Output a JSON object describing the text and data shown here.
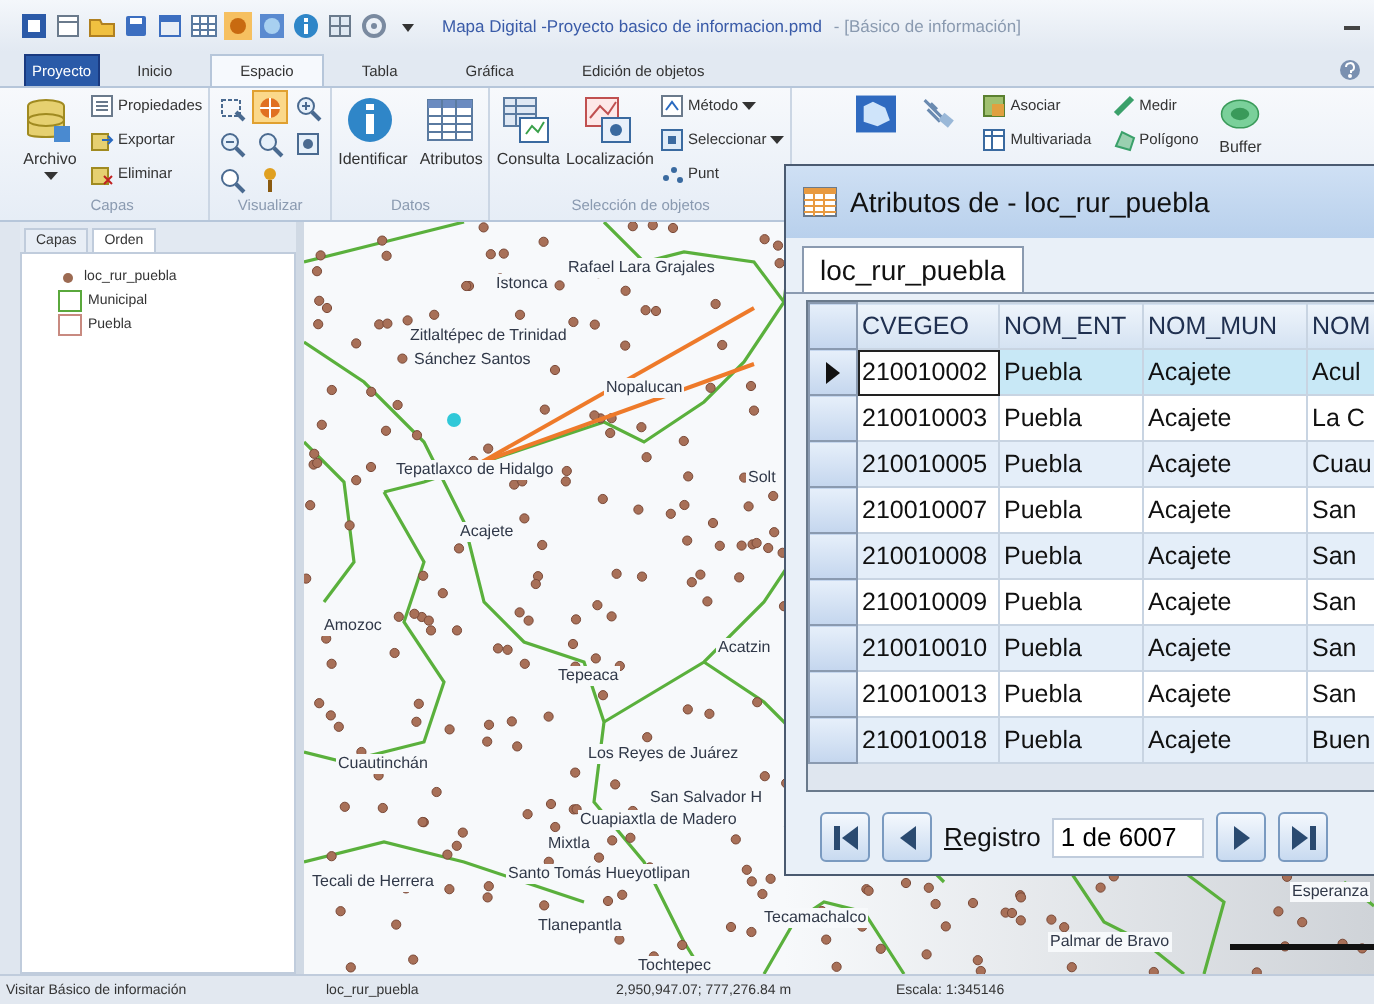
{
  "window": {
    "title": "Mapa Digital -Proyecto basico de informacion.pmd",
    "subtitle": "- [Básico de información]"
  },
  "ribbon_tabs": [
    {
      "label": "Proyecto",
      "kind": "app",
      "selected": false
    },
    {
      "label": "Inicio",
      "kind": "tab",
      "selected": false
    },
    {
      "label": "Espacio",
      "kind": "tab",
      "selected": true
    },
    {
      "label": "Tabla",
      "kind": "tab",
      "selected": false
    },
    {
      "label": "Gráfica",
      "kind": "tab",
      "selected": false
    },
    {
      "label": "Edición de objetos",
      "kind": "tab",
      "selected": false
    }
  ],
  "ribbon_groups": [
    {
      "label": "Capas",
      "items": [
        {
          "kind": "large",
          "label": "Archivo",
          "dropdown": true
        },
        {
          "kind": "small",
          "label": "Propiedades",
          "dropdown": false
        },
        {
          "kind": "small",
          "label": "Exportar",
          "dropdown": false
        },
        {
          "kind": "small",
          "label": "Eliminar",
          "dropdown": false
        }
      ]
    },
    {
      "label": "Visualizar",
      "items": [
        {
          "kind": "icon",
          "selected": false
        },
        {
          "kind": "icon",
          "selected": true
        },
        {
          "kind": "icon",
          "selected": false
        },
        {
          "kind": "icon",
          "selected": false
        },
        {
          "kind": "icon",
          "selected": false
        },
        {
          "kind": "icon",
          "selected": false
        },
        {
          "kind": "icon",
          "selected": false
        },
        {
          "kind": "icon",
          "selected": false
        }
      ]
    },
    {
      "label": "Datos",
      "items": [
        {
          "kind": "large",
          "label": "Identificar",
          "dropdown": false
        },
        {
          "kind": "large",
          "label": "Atributos",
          "dropdown": false
        }
      ]
    },
    {
      "label": "Selección de objetos",
      "items": [
        {
          "kind": "large",
          "label": "Consulta",
          "dropdown": false
        },
        {
          "kind": "large",
          "label": "Localización",
          "dropdown": false
        },
        {
          "kind": "small",
          "label": "Método",
          "dropdown": true
        },
        {
          "kind": "small",
          "label": "Seleccionar",
          "dropdown": true
        },
        {
          "kind": "small",
          "label": "Punt",
          "dropdown": false
        }
      ]
    },
    {
      "items": [
        {
          "kind": "large",
          "dropdown": false
        },
        {
          "kind": "large",
          "dropdown": false
        },
        {
          "kind": "small",
          "label": "Asociar",
          "dropdown": false
        },
        {
          "kind": "small",
          "label": "Multivariada",
          "dropdown": false
        },
        {
          "kind": "small",
          "label": "Medir",
          "dropdown": false
        },
        {
          "kind": "small",
          "label": "Polígono",
          "dropdown": false
        },
        {
          "kind": "large",
          "label": "Buffer",
          "dropdown": false
        }
      ]
    }
  ],
  "layers_panel": {
    "tabs": [
      {
        "label": "Capas",
        "selected": false
      },
      {
        "label": "Orden",
        "selected": true
      }
    ],
    "layers": [
      {
        "label": "loc_rur_puebla",
        "kind": "point",
        "color": "#9c6a52"
      },
      {
        "label": "Municipal",
        "kind": "polygon",
        "color": "#5aa83c"
      },
      {
        "label": "Puebla",
        "kind": "polygon",
        "color": "#c88a80"
      }
    ]
  },
  "map": {
    "labels": [
      {
        "text": "Istonca"
      },
      {
        "text": "Rafael Lara Grajales"
      },
      {
        "text": "Zitlaltépec de Trinidad"
      },
      {
        "text": "Sánchez Santos"
      },
      {
        "text": "Nopalucan"
      },
      {
        "text": "Tepatlaxco de Hidalgo"
      },
      {
        "text": "Solt"
      },
      {
        "text": "Acajete"
      },
      {
        "text": "Amozoc"
      },
      {
        "text": "Acatzin"
      },
      {
        "text": "Tepeaca"
      },
      {
        "text": "Cuautinchán"
      },
      {
        "text": "Los Reyes de Juárez"
      },
      {
        "text": "San Salvador H"
      },
      {
        "text": "Cuapiaxtla de Madero"
      },
      {
        "text": "Mixtla"
      },
      {
        "text": "Tecali de Herrera"
      },
      {
        "text": "Santo Tomás Hueyotlipan"
      },
      {
        "text": "Esperanza"
      },
      {
        "text": "Tlanepantla"
      },
      {
        "text": "Tecamachalco"
      },
      {
        "text": "Palmar de Bravo"
      },
      {
        "text": "Tochtepec"
      }
    ]
  },
  "attribute_window": {
    "title": "Atributos de - loc_rur_puebla",
    "tab": {
      "label": "loc_rur_puebla",
      "selected": true
    },
    "columns": [
      "CVEGEO",
      "NOM_ENT",
      "NOM_MUN",
      "NOM"
    ],
    "rows": [
      {
        "selected": true,
        "cells": [
          "210010002",
          "Puebla",
          "Acajete",
          "Acul"
        ]
      },
      {
        "selected": false,
        "cells": [
          "210010003",
          "Puebla",
          "Acajete",
          "La C"
        ]
      },
      {
        "selected": false,
        "cells": [
          "210010005",
          "Puebla",
          "Acajete",
          "Cuau"
        ]
      },
      {
        "selected": false,
        "cells": [
          "210010007",
          "Puebla",
          "Acajete",
          "San"
        ]
      },
      {
        "selected": false,
        "cells": [
          "210010008",
          "Puebla",
          "Acajete",
          "San"
        ]
      },
      {
        "selected": false,
        "cells": [
          "210010009",
          "Puebla",
          "Acajete",
          "San"
        ]
      },
      {
        "selected": false,
        "cells": [
          "210010010",
          "Puebla",
          "Acajete",
          "San"
        ]
      },
      {
        "selected": false,
        "cells": [
          "210010013",
          "Puebla",
          "Acajete",
          "San"
        ]
      },
      {
        "selected": false,
        "cells": [
          "210010018",
          "Puebla",
          "Acajete",
          "Buen"
        ]
      }
    ],
    "navigator": {
      "label": "Registro",
      "value": "1 de 6007"
    }
  },
  "status_bar": [
    "Visitar Básico de información",
    "loc_rur_puebla",
    "2,950,947.07; 777,276.84 m",
    "Escala: 1:345146"
  ]
}
